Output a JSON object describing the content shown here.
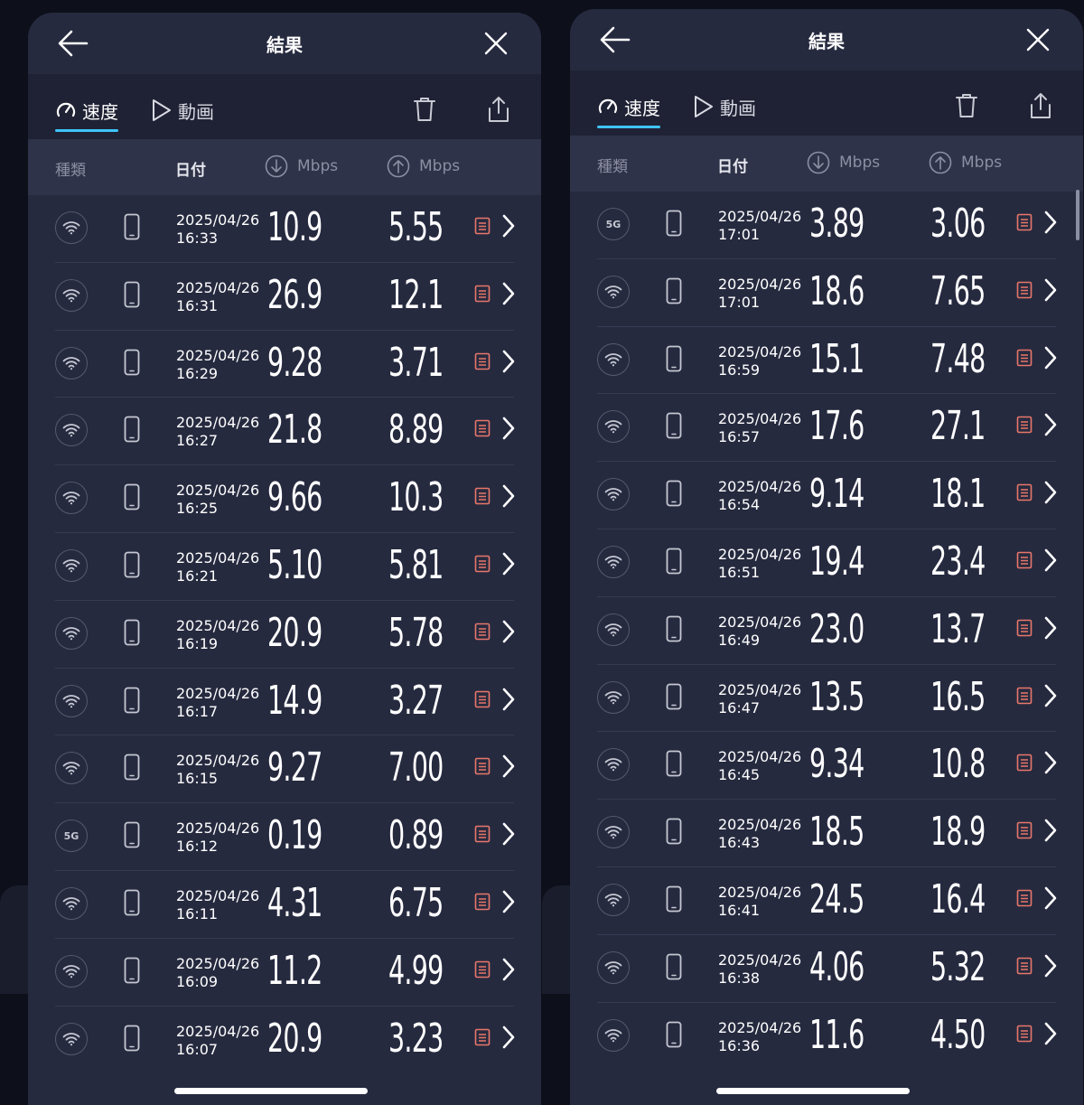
{
  "header": {
    "title": "結果"
  },
  "tabs": {
    "speed": "速度",
    "video": "動画"
  },
  "columns": {
    "type": "種類",
    "date": "日付",
    "download_unit": "Mbps",
    "upload_unit": "Mbps"
  },
  "colors": {
    "accent": "#3ec4ff",
    "doc_icon": "#e8776a"
  },
  "left_rows": [
    {
      "net": "wifi",
      "date": "2025/04/26",
      "time": "16:33",
      "dl": "10.9",
      "ul": "5.55"
    },
    {
      "net": "wifi",
      "date": "2025/04/26",
      "time": "16:31",
      "dl": "26.9",
      "ul": "12.1"
    },
    {
      "net": "wifi",
      "date": "2025/04/26",
      "time": "16:29",
      "dl": "9.28",
      "ul": "3.71"
    },
    {
      "net": "wifi",
      "date": "2025/04/26",
      "time": "16:27",
      "dl": "21.8",
      "ul": "8.89"
    },
    {
      "net": "wifi",
      "date": "2025/04/26",
      "time": "16:25",
      "dl": "9.66",
      "ul": "10.3"
    },
    {
      "net": "wifi",
      "date": "2025/04/26",
      "time": "16:21",
      "dl": "5.10",
      "ul": "5.81"
    },
    {
      "net": "wifi",
      "date": "2025/04/26",
      "time": "16:19",
      "dl": "20.9",
      "ul": "5.78"
    },
    {
      "net": "wifi",
      "date": "2025/04/26",
      "time": "16:17",
      "dl": "14.9",
      "ul": "3.27"
    },
    {
      "net": "wifi",
      "date": "2025/04/26",
      "time": "16:15",
      "dl": "9.27",
      "ul": "7.00"
    },
    {
      "net": "5G",
      "date": "2025/04/26",
      "time": "16:12",
      "dl": "0.19",
      "ul": "0.89"
    },
    {
      "net": "wifi",
      "date": "2025/04/26",
      "time": "16:11",
      "dl": "4.31",
      "ul": "6.75"
    },
    {
      "net": "wifi",
      "date": "2025/04/26",
      "time": "16:09",
      "dl": "11.2",
      "ul": "4.99"
    },
    {
      "net": "wifi",
      "date": "2025/04/26",
      "time": "16:07",
      "dl": "20.9",
      "ul": "3.23"
    }
  ],
  "right_rows": [
    {
      "net": "5G",
      "date": "2025/04/26",
      "time": "17:01",
      "dl": "3.89",
      "ul": "3.06"
    },
    {
      "net": "wifi",
      "date": "2025/04/26",
      "time": "17:01",
      "dl": "18.6",
      "ul": "7.65"
    },
    {
      "net": "wifi",
      "date": "2025/04/26",
      "time": "16:59",
      "dl": "15.1",
      "ul": "7.48"
    },
    {
      "net": "wifi",
      "date": "2025/04/26",
      "time": "16:57",
      "dl": "17.6",
      "ul": "27.1"
    },
    {
      "net": "wifi",
      "date": "2025/04/26",
      "time": "16:54",
      "dl": "9.14",
      "ul": "18.1"
    },
    {
      "net": "wifi",
      "date": "2025/04/26",
      "time": "16:51",
      "dl": "19.4",
      "ul": "23.4"
    },
    {
      "net": "wifi",
      "date": "2025/04/26",
      "time": "16:49",
      "dl": "23.0",
      "ul": "13.7"
    },
    {
      "net": "wifi",
      "date": "2025/04/26",
      "time": "16:47",
      "dl": "13.5",
      "ul": "16.5"
    },
    {
      "net": "wifi",
      "date": "2025/04/26",
      "time": "16:45",
      "dl": "9.34",
      "ul": "10.8"
    },
    {
      "net": "wifi",
      "date": "2025/04/26",
      "time": "16:43",
      "dl": "18.5",
      "ul": "18.9"
    },
    {
      "net": "wifi",
      "date": "2025/04/26",
      "time": "16:41",
      "dl": "24.5",
      "ul": "16.4"
    },
    {
      "net": "wifi",
      "date": "2025/04/26",
      "time": "16:38",
      "dl": "4.06",
      "ul": "5.32"
    },
    {
      "net": "wifi",
      "date": "2025/04/26",
      "time": "16:36",
      "dl": "11.6",
      "ul": "4.50"
    }
  ]
}
